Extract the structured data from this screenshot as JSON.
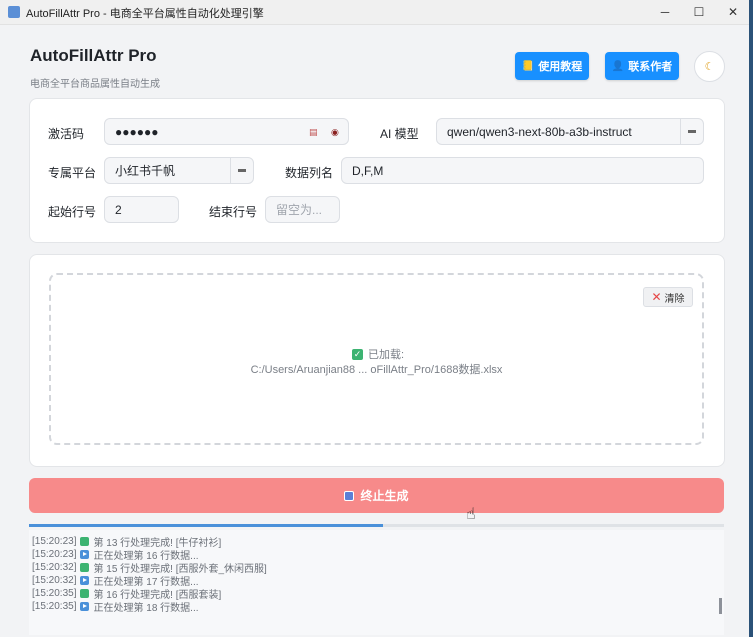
{
  "window": {
    "title": "AutoFillAttr Pro - 电商全平台属性自动化处理引擎",
    "controls": [
      "─",
      "☐",
      "✕"
    ]
  },
  "header": {
    "title": "AutoFillAttr Pro",
    "subtitle": "电商全平台商品属性自动生成",
    "tutorial_label": "使用教程",
    "contact_label": "联系作者",
    "theme_icon": "moon-icon"
  },
  "form": {
    "activation_label": "激活码",
    "activation_value": "●●●●●●",
    "ai_model_label": "AI 模型",
    "ai_model_value": "qwen/qwen3-next-80b-a3b-instruct",
    "platform_label": "专属平台",
    "platform_value": "小红书千帆",
    "columns_label": "数据列名",
    "columns_value": "D,F,M",
    "start_row_label": "起始行号",
    "start_row_value": "2",
    "end_row_label": "结束行号",
    "end_row_placeholder": "留空为..."
  },
  "file": {
    "clear_label": "清除",
    "loaded_label": "已加载:",
    "path": "C:/Users/Aruanjian88 ... oFillAttr_Pro/1688数据.xlsx"
  },
  "action": {
    "stop_label": "终止生成"
  },
  "progress": {
    "fraction": 0.51
  },
  "log": [
    {
      "type": "ok",
      "text": "[15:20:23]",
      "msg": "第 13 行处理完成!  [牛仔衬衫]"
    },
    {
      "type": "play",
      "text": "[15:20:23]",
      "msg": "正在处理第 16 行数据..."
    },
    {
      "type": "ok",
      "text": "[15:20:32]",
      "msg": "第 15 行处理完成!  [西服外套_休闲西服]"
    },
    {
      "type": "play",
      "text": "[15:20:32]",
      "msg": "正在处理第 17 行数据..."
    },
    {
      "type": "ok",
      "text": "[15:20:35]",
      "msg": "第 16 行处理完成!  [西服套装]"
    },
    {
      "type": "play",
      "text": "[15:20:35]",
      "msg": "正在处理第 18 行数据..."
    }
  ],
  "colors": {
    "primary": "#1890ff",
    "stop": "#f78a8a",
    "progress": "#4a90d9"
  }
}
